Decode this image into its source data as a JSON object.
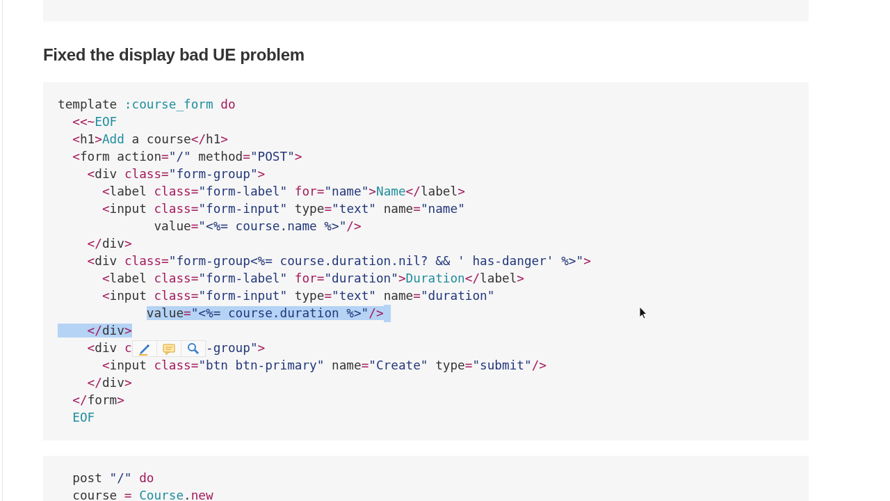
{
  "heading": "Fixed the display bad UE problem",
  "code_blocks": [
    {
      "lines": [
        [
          {
            "kind": "txt",
            "text": "template ",
            "selected": false
          },
          {
            "kind": "con",
            "text": ":course_form",
            "selected": false
          },
          {
            "kind": "kw",
            "text": " do",
            "selected": false
          }
        ],
        [
          {
            "kind": "kw",
            "text": "  <<~",
            "selected": false
          },
          {
            "kind": "con",
            "text": "EOF",
            "selected": false
          }
        ],
        [
          {
            "kind": "kw",
            "text": "  <",
            "selected": false
          },
          {
            "kind": "txt",
            "text": "h1",
            "selected": false
          },
          {
            "kind": "kw",
            "text": ">",
            "selected": false
          },
          {
            "kind": "con",
            "text": "Add",
            "selected": false
          },
          {
            "kind": "txt",
            "text": " a course",
            "selected": false
          },
          {
            "kind": "kw",
            "text": "</",
            "selected": false
          },
          {
            "kind": "txt",
            "text": "h1",
            "selected": false
          },
          {
            "kind": "kw",
            "text": ">",
            "selected": false
          }
        ],
        [
          {
            "kind": "kw",
            "text": "  <",
            "selected": false
          },
          {
            "kind": "txt",
            "text": "form action",
            "selected": false
          },
          {
            "kind": "kw",
            "text": "=",
            "selected": false
          },
          {
            "kind": "str",
            "text": "\"/\"",
            "selected": false
          },
          {
            "kind": "txt",
            "text": " method",
            "selected": false
          },
          {
            "kind": "kw",
            "text": "=",
            "selected": false
          },
          {
            "kind": "str",
            "text": "\"POST\"",
            "selected": false
          },
          {
            "kind": "kw",
            "text": ">",
            "selected": false
          }
        ],
        [
          {
            "kind": "kw",
            "text": "    <",
            "selected": false
          },
          {
            "kind": "txt",
            "text": "div ",
            "selected": false
          },
          {
            "kind": "kw",
            "text": "class=",
            "selected": false
          },
          {
            "kind": "str",
            "text": "\"form-group\"",
            "selected": false
          },
          {
            "kind": "kw",
            "text": ">",
            "selected": false
          }
        ],
        [
          {
            "kind": "kw",
            "text": "      <",
            "selected": false
          },
          {
            "kind": "txt",
            "text": "label ",
            "selected": false
          },
          {
            "kind": "kw",
            "text": "class=",
            "selected": false
          },
          {
            "kind": "str",
            "text": "\"form-label\"",
            "selected": false
          },
          {
            "kind": "kw",
            "text": " for=",
            "selected": false
          },
          {
            "kind": "str",
            "text": "\"name\"",
            "selected": false
          },
          {
            "kind": "kw",
            "text": ">",
            "selected": false
          },
          {
            "kind": "con",
            "text": "Name",
            "selected": false
          },
          {
            "kind": "kw",
            "text": "</",
            "selected": false
          },
          {
            "kind": "txt",
            "text": "label",
            "selected": false
          },
          {
            "kind": "kw",
            "text": ">",
            "selected": false
          }
        ],
        [
          {
            "kind": "kw",
            "text": "      <",
            "selected": false
          },
          {
            "kind": "txt",
            "text": "input ",
            "selected": false
          },
          {
            "kind": "kw",
            "text": "class=",
            "selected": false
          },
          {
            "kind": "str",
            "text": "\"form-input\"",
            "selected": false
          },
          {
            "kind": "txt",
            "text": " type",
            "selected": false
          },
          {
            "kind": "kw",
            "text": "=",
            "selected": false
          },
          {
            "kind": "str",
            "text": "\"text\"",
            "selected": false
          },
          {
            "kind": "txt",
            "text": " name",
            "selected": false
          },
          {
            "kind": "kw",
            "text": "=",
            "selected": false
          },
          {
            "kind": "str",
            "text": "\"name\"",
            "selected": false
          }
        ],
        [
          {
            "kind": "txt",
            "text": "             value",
            "selected": false
          },
          {
            "kind": "kw",
            "text": "=",
            "selected": false
          },
          {
            "kind": "str",
            "text": "\"<%= course.name %>\"",
            "selected": false
          },
          {
            "kind": "kw",
            "text": "/>",
            "selected": false
          }
        ],
        [
          {
            "kind": "kw",
            "text": "    </",
            "selected": false
          },
          {
            "kind": "txt",
            "text": "div",
            "selected": false
          },
          {
            "kind": "kw",
            "text": ">",
            "selected": false
          }
        ],
        [
          {
            "kind": "kw",
            "text": "    <",
            "selected": false
          },
          {
            "kind": "txt",
            "text": "div ",
            "selected": false
          },
          {
            "kind": "kw",
            "text": "class=",
            "selected": false
          },
          {
            "kind": "str",
            "text": "\"form-group<%= course.duration.nil? && ' has-danger' %>\"",
            "selected": false
          },
          {
            "kind": "kw",
            "text": ">",
            "selected": false
          }
        ],
        [
          {
            "kind": "kw",
            "text": "      <",
            "selected": false
          },
          {
            "kind": "txt",
            "text": "label ",
            "selected": false
          },
          {
            "kind": "kw",
            "text": "class=",
            "selected": false
          },
          {
            "kind": "str",
            "text": "\"form-label\"",
            "selected": false
          },
          {
            "kind": "kw",
            "text": " for=",
            "selected": false
          },
          {
            "kind": "str",
            "text": "\"duration\"",
            "selected": false
          },
          {
            "kind": "kw",
            "text": ">",
            "selected": false
          },
          {
            "kind": "con",
            "text": "Duration",
            "selected": false
          },
          {
            "kind": "kw",
            "text": "</",
            "selected": false
          },
          {
            "kind": "txt",
            "text": "label",
            "selected": false
          },
          {
            "kind": "kw",
            "text": ">",
            "selected": false
          }
        ],
        [
          {
            "kind": "kw",
            "text": "      <",
            "selected": false
          },
          {
            "kind": "txt",
            "text": "input ",
            "selected": false
          },
          {
            "kind": "kw",
            "text": "class=",
            "selected": false
          },
          {
            "kind": "str",
            "text": "\"form-input\"",
            "selected": false
          },
          {
            "kind": "txt",
            "text": " type",
            "selected": false
          },
          {
            "kind": "kw",
            "text": "=",
            "selected": false
          },
          {
            "kind": "str",
            "text": "\"text\"",
            "selected": false
          },
          {
            "kind": "txt",
            "text": " name",
            "selected": false
          },
          {
            "kind": "kw",
            "text": "=",
            "selected": false
          },
          {
            "kind": "str",
            "text": "\"duration\"",
            "selected": false
          }
        ],
        [
          {
            "kind": "txt",
            "text": "            value",
            "selected": true
          },
          {
            "kind": "kw",
            "text": "=",
            "selected": true
          },
          {
            "kind": "str",
            "text": "\"<%= course.duration %>\"",
            "selected": true
          },
          {
            "kind": "kw",
            "text": "/>",
            "selected": true
          }
        ],
        [
          {
            "kind": "kw",
            "text": "    </",
            "selected": true
          },
          {
            "kind": "txt",
            "text": "div",
            "selected": true
          },
          {
            "kind": "kw",
            "text": ">",
            "selected": true
          }
        ],
        [
          {
            "kind": "kw",
            "text": "    <",
            "selected": false
          },
          {
            "kind": "txt",
            "text": "div ",
            "selected": false
          },
          {
            "kind": "kw",
            "text": "c",
            "selected": false
          },
          {
            "kind": "toolbar"
          },
          {
            "kind": "str",
            "text": "-group\"",
            "selected": false
          },
          {
            "kind": "kw",
            "text": ">",
            "selected": false
          }
        ],
        [
          {
            "kind": "kw",
            "text": "      <",
            "selected": false
          },
          {
            "kind": "txt",
            "text": "input ",
            "selected": false
          },
          {
            "kind": "kw",
            "text": "class=",
            "selected": false
          },
          {
            "kind": "str",
            "text": "\"btn btn-primary\"",
            "selected": false
          },
          {
            "kind": "txt",
            "text": " name",
            "selected": false
          },
          {
            "kind": "kw",
            "text": "=",
            "selected": false
          },
          {
            "kind": "str",
            "text": "\"Create\"",
            "selected": false
          },
          {
            "kind": "txt",
            "text": " type",
            "selected": false
          },
          {
            "kind": "kw",
            "text": "=",
            "selected": false
          },
          {
            "kind": "str",
            "text": "\"submit\"",
            "selected": false
          },
          {
            "kind": "kw",
            "text": "/>",
            "selected": false
          }
        ],
        [
          {
            "kind": "kw",
            "text": "    </",
            "selected": false
          },
          {
            "kind": "txt",
            "text": "div",
            "selected": false
          },
          {
            "kind": "kw",
            "text": ">",
            "selected": false
          }
        ],
        [
          {
            "kind": "kw",
            "text": "  </",
            "selected": false
          },
          {
            "kind": "txt",
            "text": "form",
            "selected": false
          },
          {
            "kind": "kw",
            "text": ">",
            "selected": false
          }
        ],
        [
          {
            "kind": "con",
            "text": "  EOF",
            "selected": false
          }
        ]
      ]
    },
    {
      "lines": [
        [
          {
            "kind": "txt",
            "text": "  post ",
            "selected": false
          },
          {
            "kind": "str",
            "text": "\"/\"",
            "selected": false
          },
          {
            "kind": "kw",
            "text": " do",
            "selected": false
          }
        ],
        [
          {
            "kind": "txt",
            "text": "  course ",
            "selected": false
          },
          {
            "kind": "kw",
            "text": "=",
            "selected": false
          },
          {
            "kind": "con",
            "text": " Course",
            "selected": false
          },
          {
            "kind": "txt",
            "text": ".",
            "selected": false
          },
          {
            "kind": "kw",
            "text": "new",
            "selected": false
          }
        ]
      ]
    }
  ]
}
